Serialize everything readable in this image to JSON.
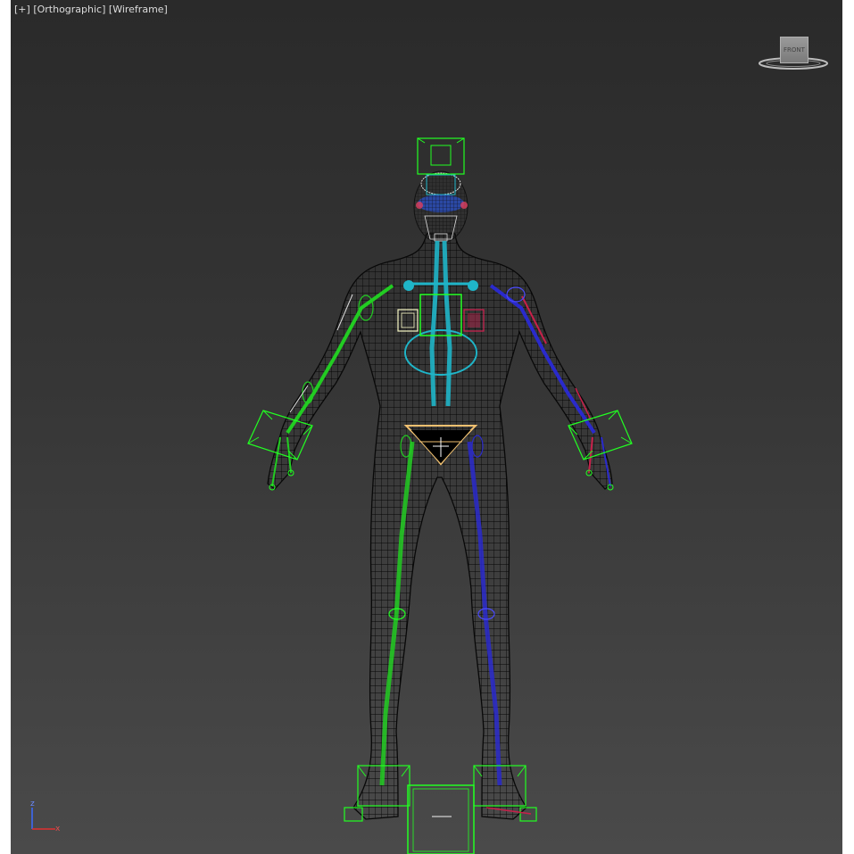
{
  "viewport": {
    "label": {
      "plus": "[+]",
      "projection": "[Orthographic]",
      "shading": "[Wireframe]"
    },
    "viewcube": {
      "face_label": "FRONT"
    },
    "axis": {
      "z": "z",
      "x": "x"
    },
    "colors": {
      "bg_top": "#2a2a2a",
      "bg_bottom": "#4a4a4a",
      "mesh": "#0a0a0a",
      "bone_left": "#22cc22",
      "bone_right": "#2a2acc",
      "spine": "#1fb5c8",
      "pelvis": "#f0c070",
      "control": "#22ff22",
      "accent_red": "#c8204a"
    }
  }
}
